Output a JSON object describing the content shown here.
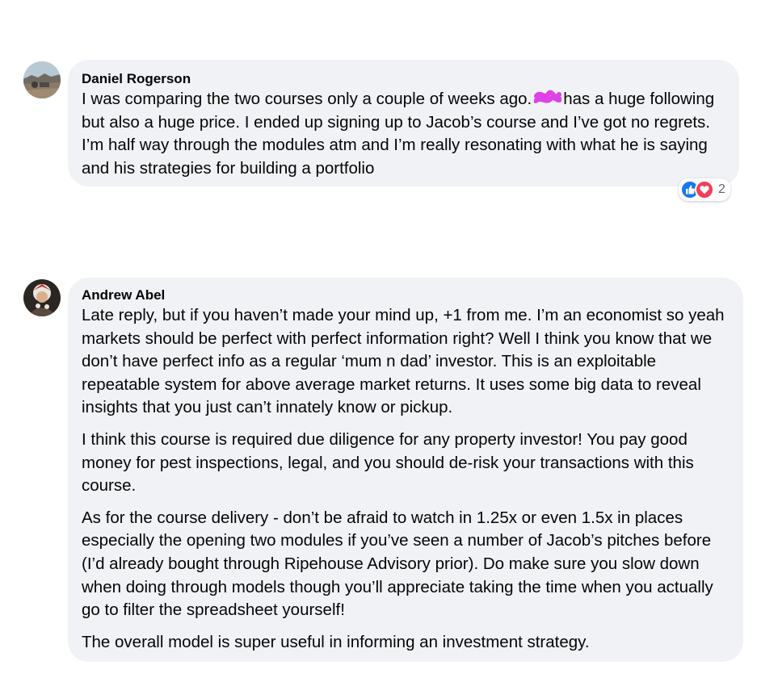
{
  "comments": [
    {
      "author": "Daniel Rogerson",
      "text_before": "I was comparing the two courses only a couple of weeks ago.",
      "text_after": "has a huge following but also a huge price. I ended up signing up to Jacob’s course and I’ve got no regrets. I’m half way through the modules atm and I’m really resonating with what he is saying and his strategies for building a portfolio",
      "reactions": {
        "icons": [
          "like-icon",
          "love-icon"
        ],
        "count": "2",
        "like_color": "#1877f2",
        "love_color": "#f33e58"
      }
    },
    {
      "author": "Andrew Abel",
      "paragraphs": [
        "Late reply, but if you haven’t made your mind up, +1 from me. I’m an economist so yeah markets should be perfect with perfect information right? Well I think you know that we don’t have perfect info as a regular ‘mum n dad’ investor. This is an exploitable repeatable system for above average market returns. It uses some big data to reveal insights that you just can’t innately know or pickup.",
        "I think this course is required due diligence for any property investor! You pay good money for pest inspections, legal, and you should de-risk your transactions with this course.",
        "As for the course delivery - don’t be afraid to watch in 1.25x or even 1.5x in places especially the opening two modules if you’ve seen a number of Jacob’s pitches before (I’d already bought through Ripehouse Advisory prior). Do make sure you slow down when doing through models though you’ll appreciate taking the time when you actually go to filter the spreadsheet yourself!",
        "The overall model is super useful in informing an investment strategy."
      ]
    }
  ],
  "colors": {
    "bubble_bg": "#f0f2f5",
    "text": "#050505",
    "redaction": "#e040e8"
  }
}
